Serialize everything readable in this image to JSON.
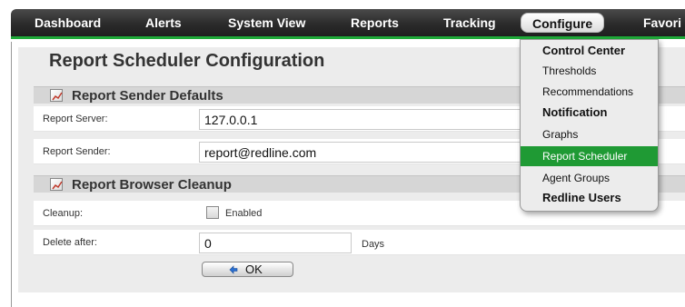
{
  "nav": {
    "items": [
      {
        "label": "Dashboard"
      },
      {
        "label": "Alerts"
      },
      {
        "label": "System View"
      },
      {
        "label": "Reports"
      },
      {
        "label": "Tracking"
      },
      {
        "label": "Configure",
        "active": true
      },
      {
        "label": "Favori"
      }
    ]
  },
  "page": {
    "title": "Report Scheduler Configuration"
  },
  "sender_defaults": {
    "title": "Report Sender Defaults",
    "server_label": "Report Server:",
    "server_value": "127.0.0.1",
    "sender_label": "Report Sender:",
    "sender_value": "report@redline.com"
  },
  "browser_cleanup": {
    "title": "Report Browser Cleanup",
    "cleanup_label": "Cleanup:",
    "enabled_label": "Enabled",
    "enabled_checked": false,
    "delete_label": "Delete after:",
    "delete_value": "0",
    "days_label": "Days",
    "ok_label": "OK"
  },
  "configure_menu": {
    "items": [
      {
        "label": "Control Center",
        "bold": true
      },
      {
        "label": "Thresholds",
        "bold": false
      },
      {
        "label": "Recommendations",
        "bold": false
      },
      {
        "label": "Notification",
        "bold": true
      },
      {
        "label": "Graphs",
        "bold": false
      },
      {
        "label": "Report Scheduler",
        "bold": false,
        "selected": true
      },
      {
        "label": "Agent Groups",
        "bold": false
      },
      {
        "label": "Redline Users",
        "bold": true
      }
    ]
  },
  "colors": {
    "accent_green": "#1f9a34",
    "navbar_dark": "#2b2b2b",
    "panel_bg": "#ececec",
    "section_bg": "#d6d6d6"
  },
  "icons": {
    "section": "report-chart-icon",
    "ok": "refresh-arrow-icon"
  }
}
